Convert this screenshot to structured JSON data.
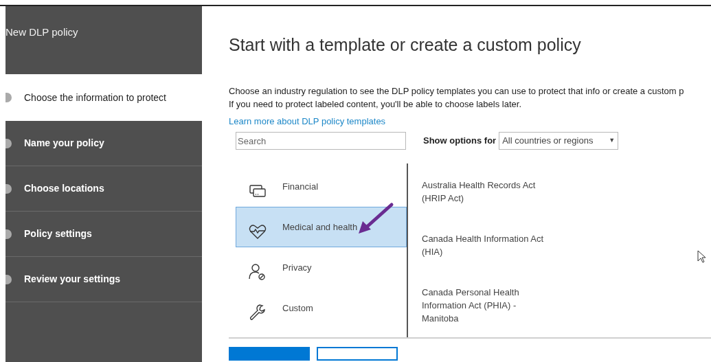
{
  "panel_title": "New DLP policy",
  "steps": [
    {
      "label": "Choose the information to protect",
      "selected": true
    },
    {
      "label": "Name your policy",
      "selected": false
    },
    {
      "label": "Choose locations",
      "selected": false
    },
    {
      "label": "Policy settings",
      "selected": false
    },
    {
      "label": "Review your settings",
      "selected": false
    }
  ],
  "heading": "Start with a template or create a custom policy",
  "description": [
    "Choose an industry regulation to see the DLP policy templates you can use to protect that info or create a custom p",
    "If you need to protect labeled content, you'll be able to choose labels later."
  ],
  "learn_more_link": "Learn more about DLP policy templates",
  "search": {
    "placeholder": "Search"
  },
  "show_options": {
    "label": "Show options for",
    "value": "All countries or regions",
    "caret": "▼"
  },
  "categories": [
    {
      "kind": "financial",
      "label": "Financial",
      "selected": false
    },
    {
      "kind": "medical",
      "label": "Medical and health",
      "selected": true
    },
    {
      "kind": "privacy",
      "label": "Privacy",
      "selected": false
    },
    {
      "kind": "custom",
      "label": "Custom",
      "selected": false
    }
  ],
  "templates": [
    {
      "lines": [
        "Australia Health Records Act",
        "(HRIP Act)"
      ]
    },
    {
      "lines": [
        "Canada Health Information Act",
        "(HIA)"
      ]
    },
    {
      "lines": [
        "Canada Personal Health",
        "Information Act (PHIA) -",
        "Manitoba"
      ]
    }
  ]
}
